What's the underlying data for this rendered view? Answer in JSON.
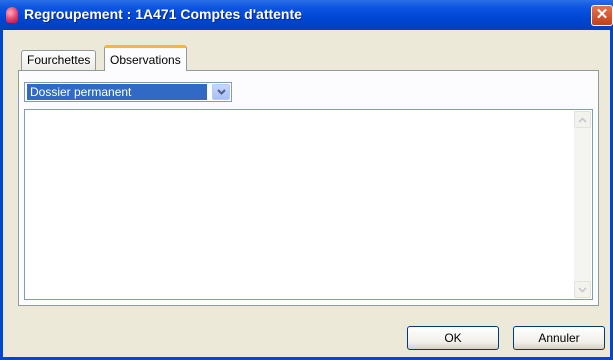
{
  "window": {
    "title": "Regroupement : 1A471 Comptes d'attente",
    "close_label": "✕"
  },
  "tabs": [
    {
      "label": "Fourchettes",
      "active": false
    },
    {
      "label": "Observations",
      "active": true
    }
  ],
  "observations": {
    "category_select": {
      "selected": "Dossier permanent"
    },
    "text": ""
  },
  "footer": {
    "ok_label": "OK",
    "cancel_label": "Annuler"
  },
  "colors": {
    "titlebar": "#0046d5",
    "active_tab_accent": "#f6b53c",
    "selection": "#316ac5"
  }
}
